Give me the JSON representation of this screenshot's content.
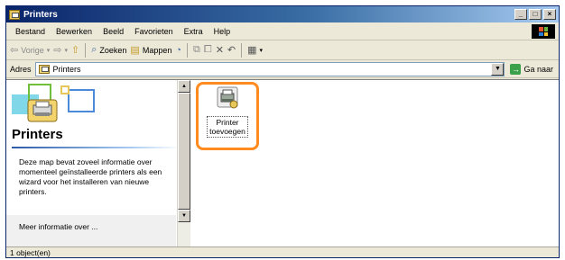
{
  "window": {
    "title": "Printers",
    "buttons": {
      "minimize": "_",
      "maximize": "□",
      "close": "×"
    }
  },
  "menu": {
    "items": [
      "Bestand",
      "Bewerken",
      "Beeld",
      "Favorieten",
      "Extra",
      "Help"
    ]
  },
  "toolbar": {
    "back": "Vorige",
    "search": "Zoeken",
    "folders": "Mappen",
    "icons": [
      "forward-icon",
      "up-folder-icon",
      "search-icon",
      "folders-icon",
      "history-icon",
      "move-to-icon",
      "copy-to-icon",
      "delete-icon",
      "undo-icon",
      "views-icon"
    ]
  },
  "address": {
    "label": "Adres",
    "value": "Printers",
    "go": "Ga naar"
  },
  "left_pane": {
    "title": "Printers",
    "description": "Deze map bevat zoveel informatie over momenteel geïnstalleerde printers als een wizard voor het installeren van nieuwe printers.",
    "truncated_line": "Meer informatie over ..."
  },
  "items": [
    {
      "label_line1": "Printer",
      "label_line2": "toevoegen",
      "icon": "add-printer-icon",
      "highlighted": true
    }
  ],
  "status": {
    "text": "1 object(en)"
  },
  "colors": {
    "highlight": "#ff8a1f",
    "titlebar": "#0a246a"
  }
}
